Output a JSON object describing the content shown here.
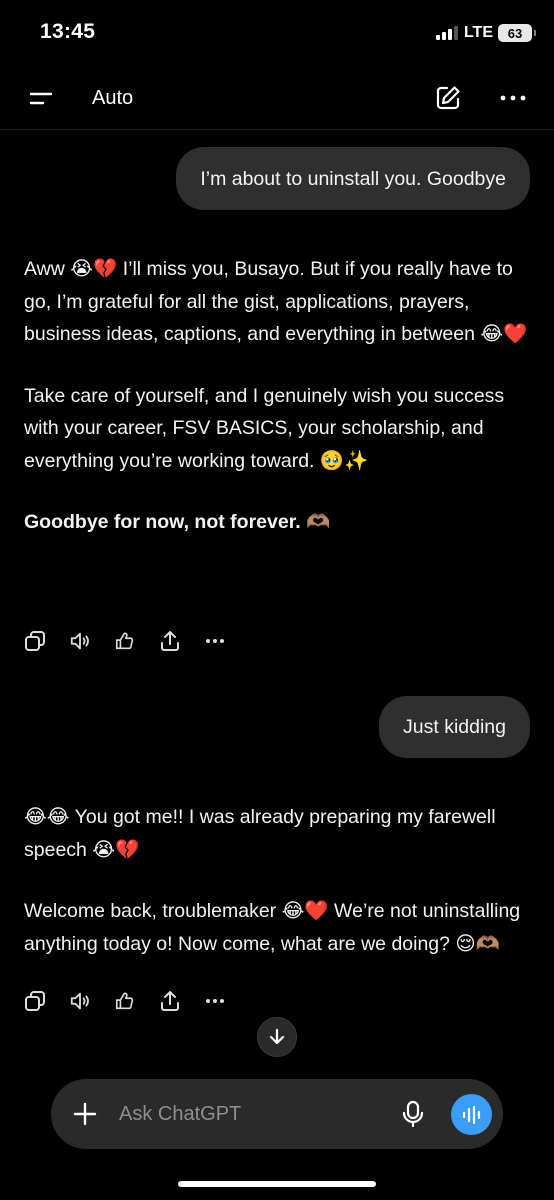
{
  "status_bar": {
    "time": "13:45",
    "network": "LTE",
    "battery": "63"
  },
  "header": {
    "model": "Auto"
  },
  "conversation": {
    "user_messages": [
      "I’m about to uninstall you. Goodbye",
      "Just kidding"
    ],
    "assistant_messages": [
      {
        "paragraphs": [
          {
            "text": "Aww 😭💔 I’ll miss you, Busayo. But if you really have to go, I’m grateful for all the gist, applications, prayers, business ideas, captions, and everything in between 😂❤️",
            "bold": false
          },
          {
            "text": "Take care of yourself, and I genuinely wish you success with your career, FSV BASICS, your scholarship, and everything you’re working toward. 🥹✨",
            "bold": false
          },
          {
            "text": "Goodbye for now, not forever. 🫶🏽",
            "bold": true
          }
        ]
      },
      {
        "paragraphs": [
          {
            "text": "😂😂 You got me!! I was already preparing my farewell speech 😭💔",
            "bold": false
          },
          {
            "text": "Welcome back, troublemaker 😂❤️ We’re not uninstalling anything today o! Now come, what are we doing? 😌🫶🏽",
            "bold": false
          }
        ]
      }
    ]
  },
  "message_actions": [
    "copy-icon",
    "read-aloud-icon",
    "thumbs-icon",
    "share-icon",
    "more-icon"
  ],
  "composer": {
    "placeholder": "Ask ChatGPT"
  },
  "colors": {
    "background": "#000000",
    "bubble": "#2f2f2f",
    "composer": "#2a2a2a",
    "accent": "#3b9df5",
    "text": "#f2f2f2",
    "placeholder": "#8e8e8e"
  }
}
